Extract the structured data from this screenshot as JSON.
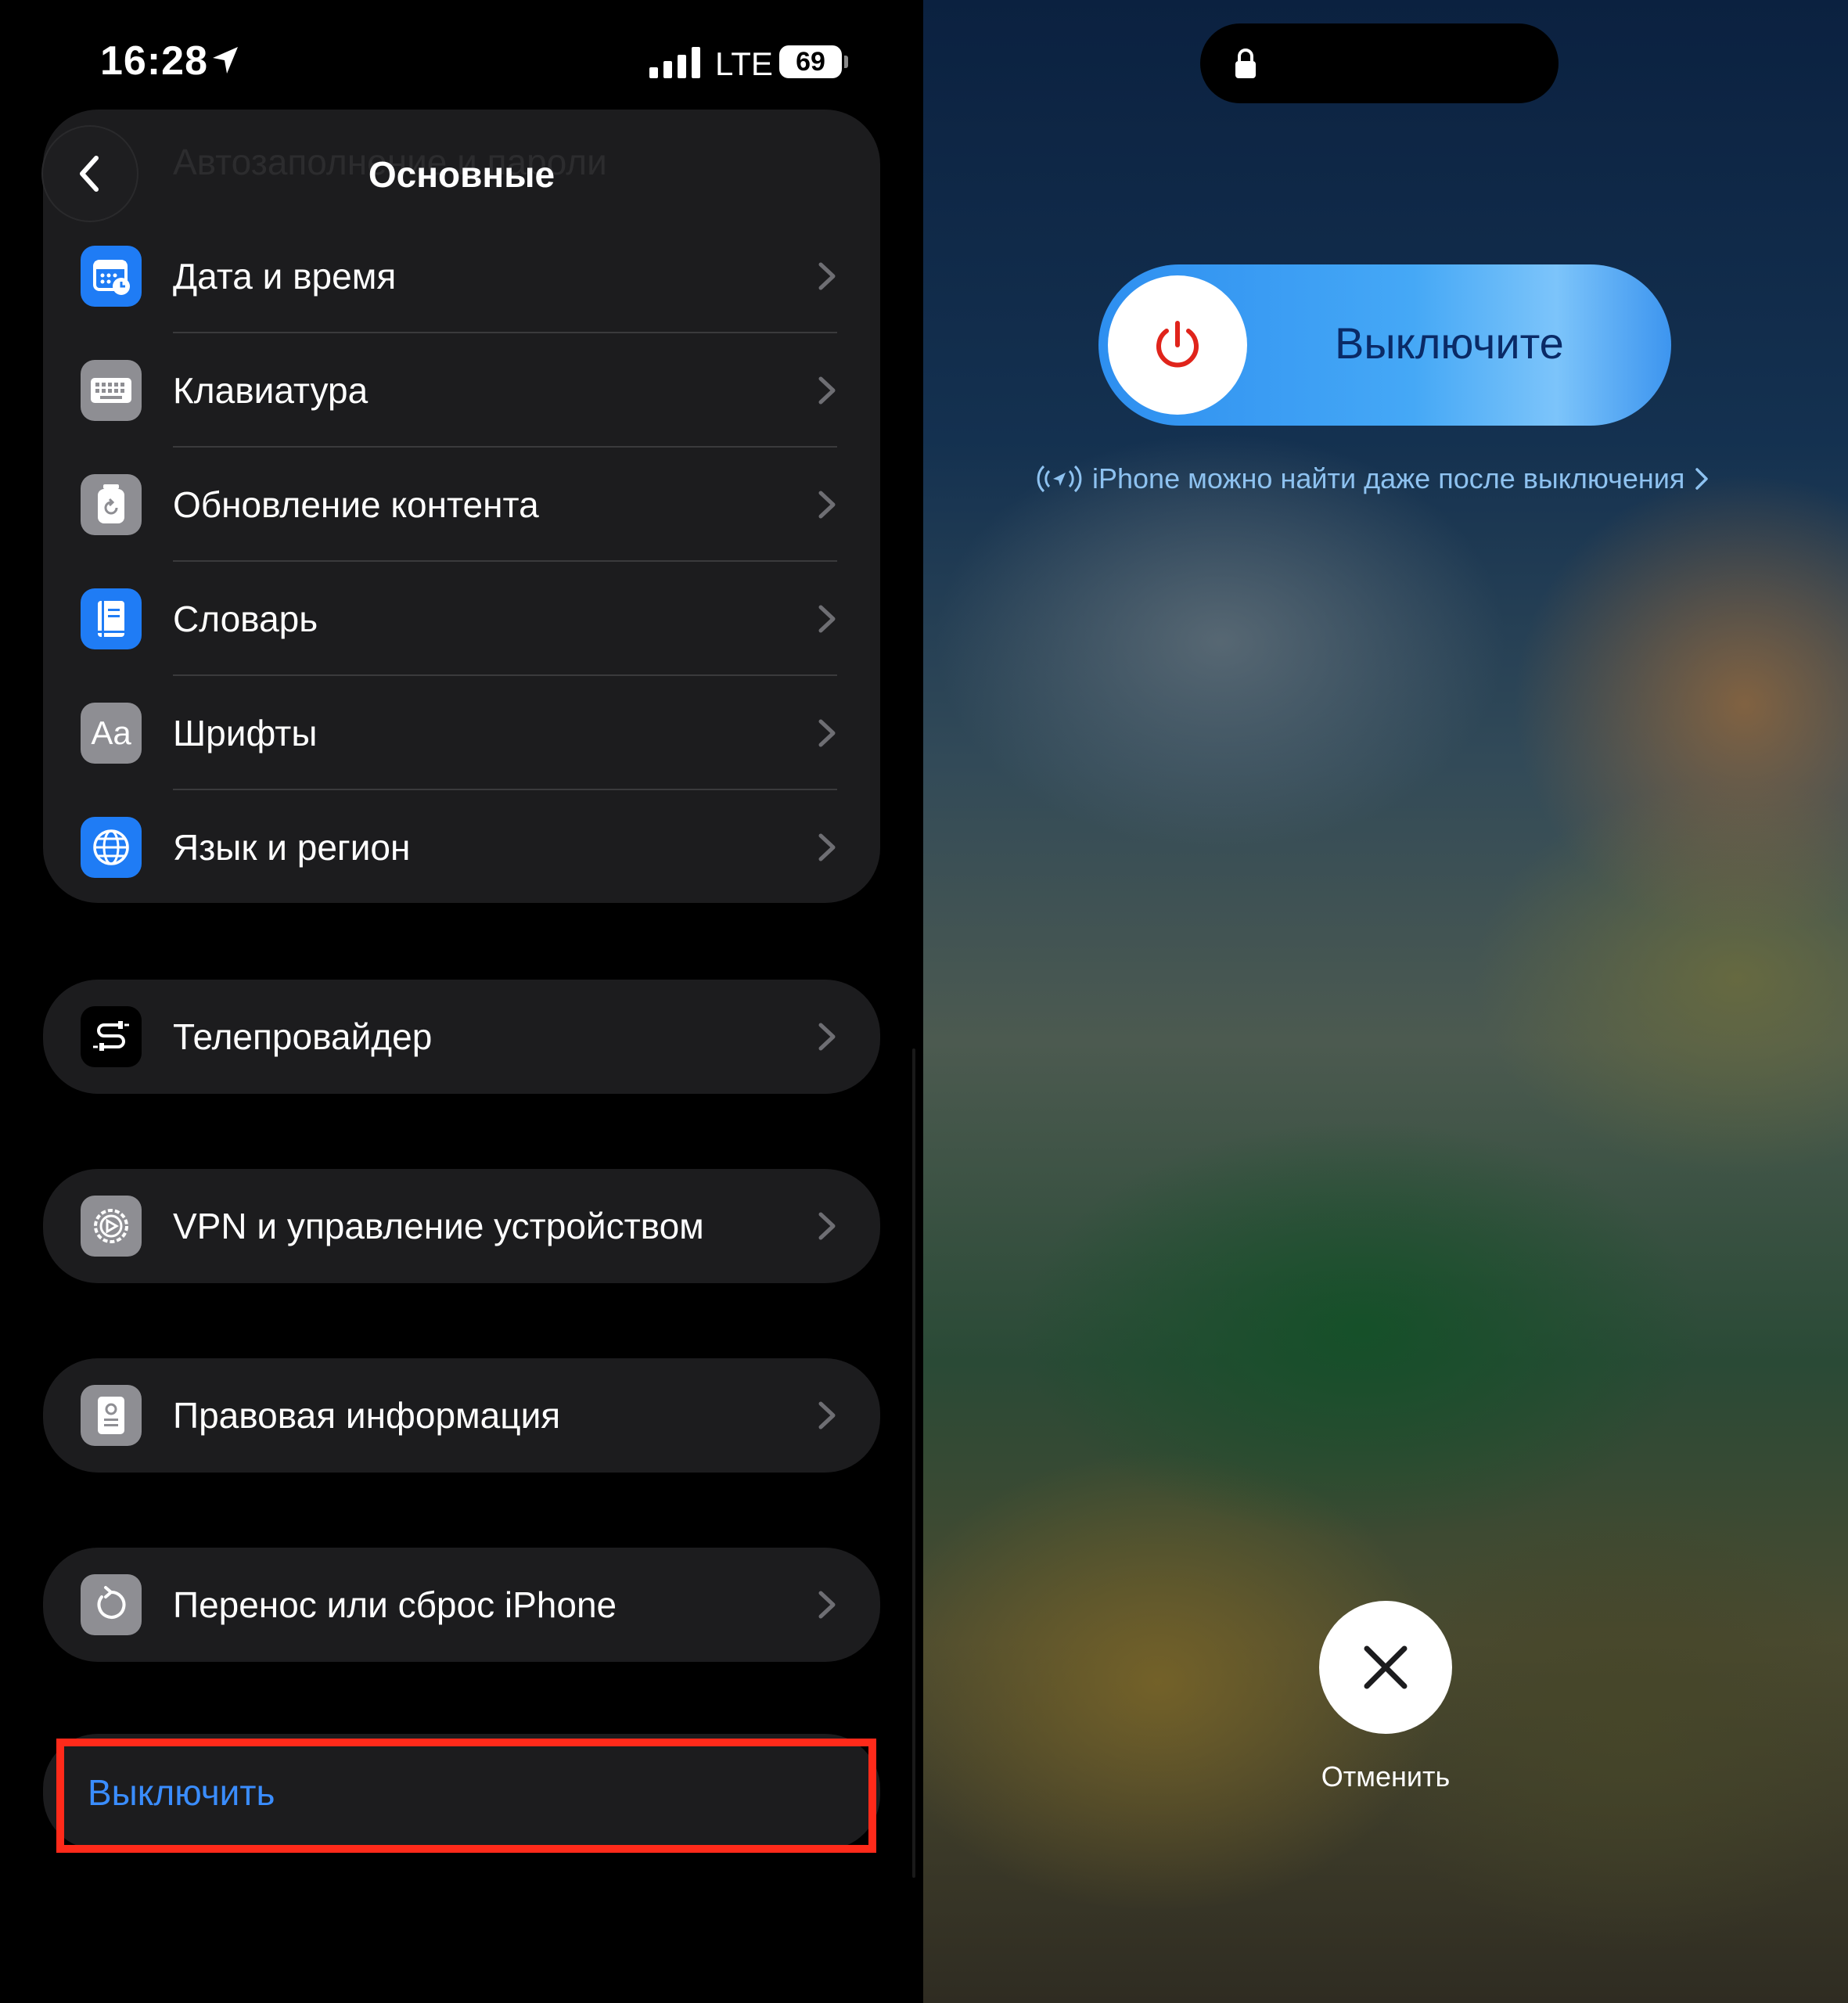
{
  "status_bar": {
    "time": "16:28",
    "network": "LTE",
    "battery": "69"
  },
  "settings": {
    "title": "Основные",
    "ghost_row": "Автозаполнение и пароли",
    "group1": [
      {
        "label": "Дата и время",
        "icon": "calendar-clock-icon",
        "color": "#1f7cf5"
      },
      {
        "label": "Клавиатура",
        "icon": "keyboard-icon",
        "color": "#8e8e93"
      },
      {
        "label": "Обновление контента",
        "icon": "refresh-app-icon",
        "color": "#8e8e93"
      },
      {
        "label": "Словарь",
        "icon": "dictionary-book-icon",
        "color": "#1f7cf5"
      },
      {
        "label": "Шрифты",
        "icon": "fonts-icon",
        "icon_text": "Aa",
        "color": "#8e8e93"
      },
      {
        "label": "Язык и регион",
        "icon": "globe-icon",
        "color": "#1f7cf5"
      }
    ],
    "tv_provider": {
      "label": "Телепровайдер",
      "icon": "tv-provider-icon"
    },
    "vpn": {
      "label": "VPN и управление устройством",
      "icon": "gear-icon"
    },
    "legal": {
      "label": "Правовая информация",
      "icon": "legal-document-icon"
    },
    "transfer": {
      "label": "Перенос или сброс iPhone",
      "icon": "reset-icon"
    },
    "shutdown": {
      "label": "Выключить",
      "color": "#3a8dff"
    },
    "highlight_color": "#ff2a1a"
  },
  "power_off": {
    "slider_label": "Выключите",
    "find_my": "iPhone можно найти даже после выключения",
    "cancel_label": "Отменить",
    "power_icon_color": "#e0241b"
  }
}
